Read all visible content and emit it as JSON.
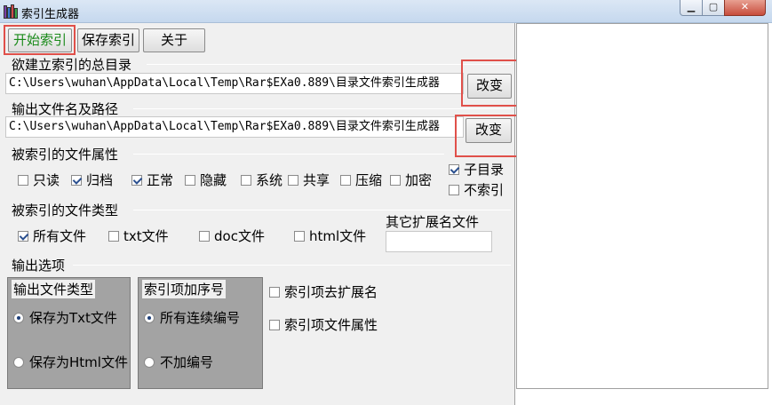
{
  "window": {
    "title": "索引生成器",
    "min": "▁",
    "max": "▢",
    "close": "✕"
  },
  "toolbar": {
    "start": "开始索引",
    "save": "保存索引",
    "about": "关于"
  },
  "root_dir": {
    "label": "欲建立索引的总目录",
    "value": "C:\\Users\\wuhan\\AppData\\Local\\Temp\\Rar$EXa0.889\\目录文件索引生成器",
    "change": "改变"
  },
  "output": {
    "label": "输出文件名及路径",
    "value": "C:\\Users\\wuhan\\AppData\\Local\\Temp\\Rar$EXa0.889\\目录文件索引生成器",
    "change": "改变"
  },
  "attributes": {
    "label": "被索引的文件属性",
    "items": [
      {
        "label": "只读",
        "checked": false
      },
      {
        "label": "归档",
        "checked": true
      },
      {
        "label": "正常",
        "checked": true
      },
      {
        "label": "隐藏",
        "checked": false
      },
      {
        "label": "系统",
        "checked": false
      },
      {
        "label": "共享",
        "checked": false
      },
      {
        "label": "压缩",
        "checked": false
      },
      {
        "label": "加密",
        "checked": false
      }
    ],
    "subdir": {
      "label": "子目录",
      "checked": true
    },
    "noindex": {
      "label": "不索引",
      "checked": false
    }
  },
  "types": {
    "label": "被索引的文件类型",
    "items": [
      {
        "label": "所有文件",
        "checked": true
      },
      {
        "label": "txt文件",
        "checked": false
      },
      {
        "label": "doc文件",
        "checked": false
      },
      {
        "label": "html文件",
        "checked": false
      }
    ],
    "other_ext_label": "其它扩展名文件",
    "other_ext_value": ""
  },
  "output_options": {
    "label": "输出选项",
    "file_type": {
      "title": "输出文件类型",
      "txt": "保存为Txt文件",
      "html": "保存为Html文件",
      "selected": "txt"
    },
    "numbering": {
      "title": "索引项加序号",
      "continuous": "所有连续编号",
      "none": "不加编号",
      "selected": "continuous"
    },
    "remove_ext": {
      "label": "索引项去扩展名",
      "checked": false
    },
    "file_attr": {
      "label": "索引项文件属性",
      "checked": false
    }
  },
  "colors": {
    "start_text": "#1a8a1a",
    "highlight": "#e0504a"
  }
}
